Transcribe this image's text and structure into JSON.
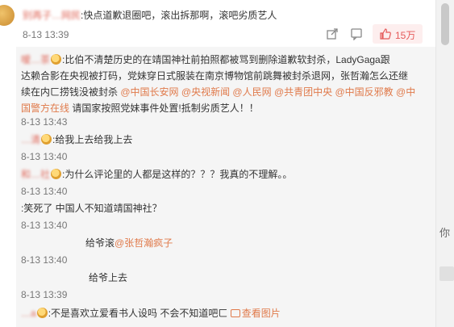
{
  "top_comment": {
    "user": "别再子…网民",
    "text": ":快点道歉退圈吧，滚出拆那啊，滚吧劣质艺人",
    "time": "8-13 13:39",
    "likes": "15万"
  },
  "replies": [
    {
      "user": "嗳…茶",
      "text_lines": [
        ":比伯不清楚历史的在靖国神社前拍照都被骂到删除道歉软封杀，LadyGaga跟",
        "达赖合影在央视被打码，党妹穿日式服装在南京博物馆前跳舞被封杀退网，张哲瀚怎么还继",
        "续在内ㄈ捞钱没被封杀"
      ],
      "mentions": [
        "@中国长安网",
        "@央视新闻",
        "@人民网",
        "@共青团中央",
        "@中国反邪教",
        "@中",
        "国警方在线"
      ],
      "tail": "请国家按照党妹事件处置!抵制劣质艺人！！",
      "time": "8-13 13:43"
    },
    {
      "user": "…清",
      "text": ":给我上去给我上去",
      "time": "8-13 13:40"
    },
    {
      "user": "和…社",
      "text": ":为什么评论里的人都是这样的？？？我真的不理解。。",
      "time": "8-13 13:40"
    },
    {
      "user": "",
      "text": ":笑死了 中国人不知道靖国神社？",
      "time": "8-13 13:40"
    },
    {
      "user": "",
      "text": "给爷滚",
      "mention": "@张哲瀚疯子",
      "time": "8-13 13:40"
    },
    {
      "user": "",
      "text": "给爷上去",
      "time": "8-13 13:39"
    },
    {
      "user": "…a",
      "text": ":不是喜欢立爱看书人设吗 不会不知道吧ㄈ",
      "link": "查看图片"
    }
  ],
  "sidebar_peek": "你",
  "colors": {
    "name": "#e06a5c",
    "link": "#e07a4b",
    "like": "#e55a5a"
  }
}
